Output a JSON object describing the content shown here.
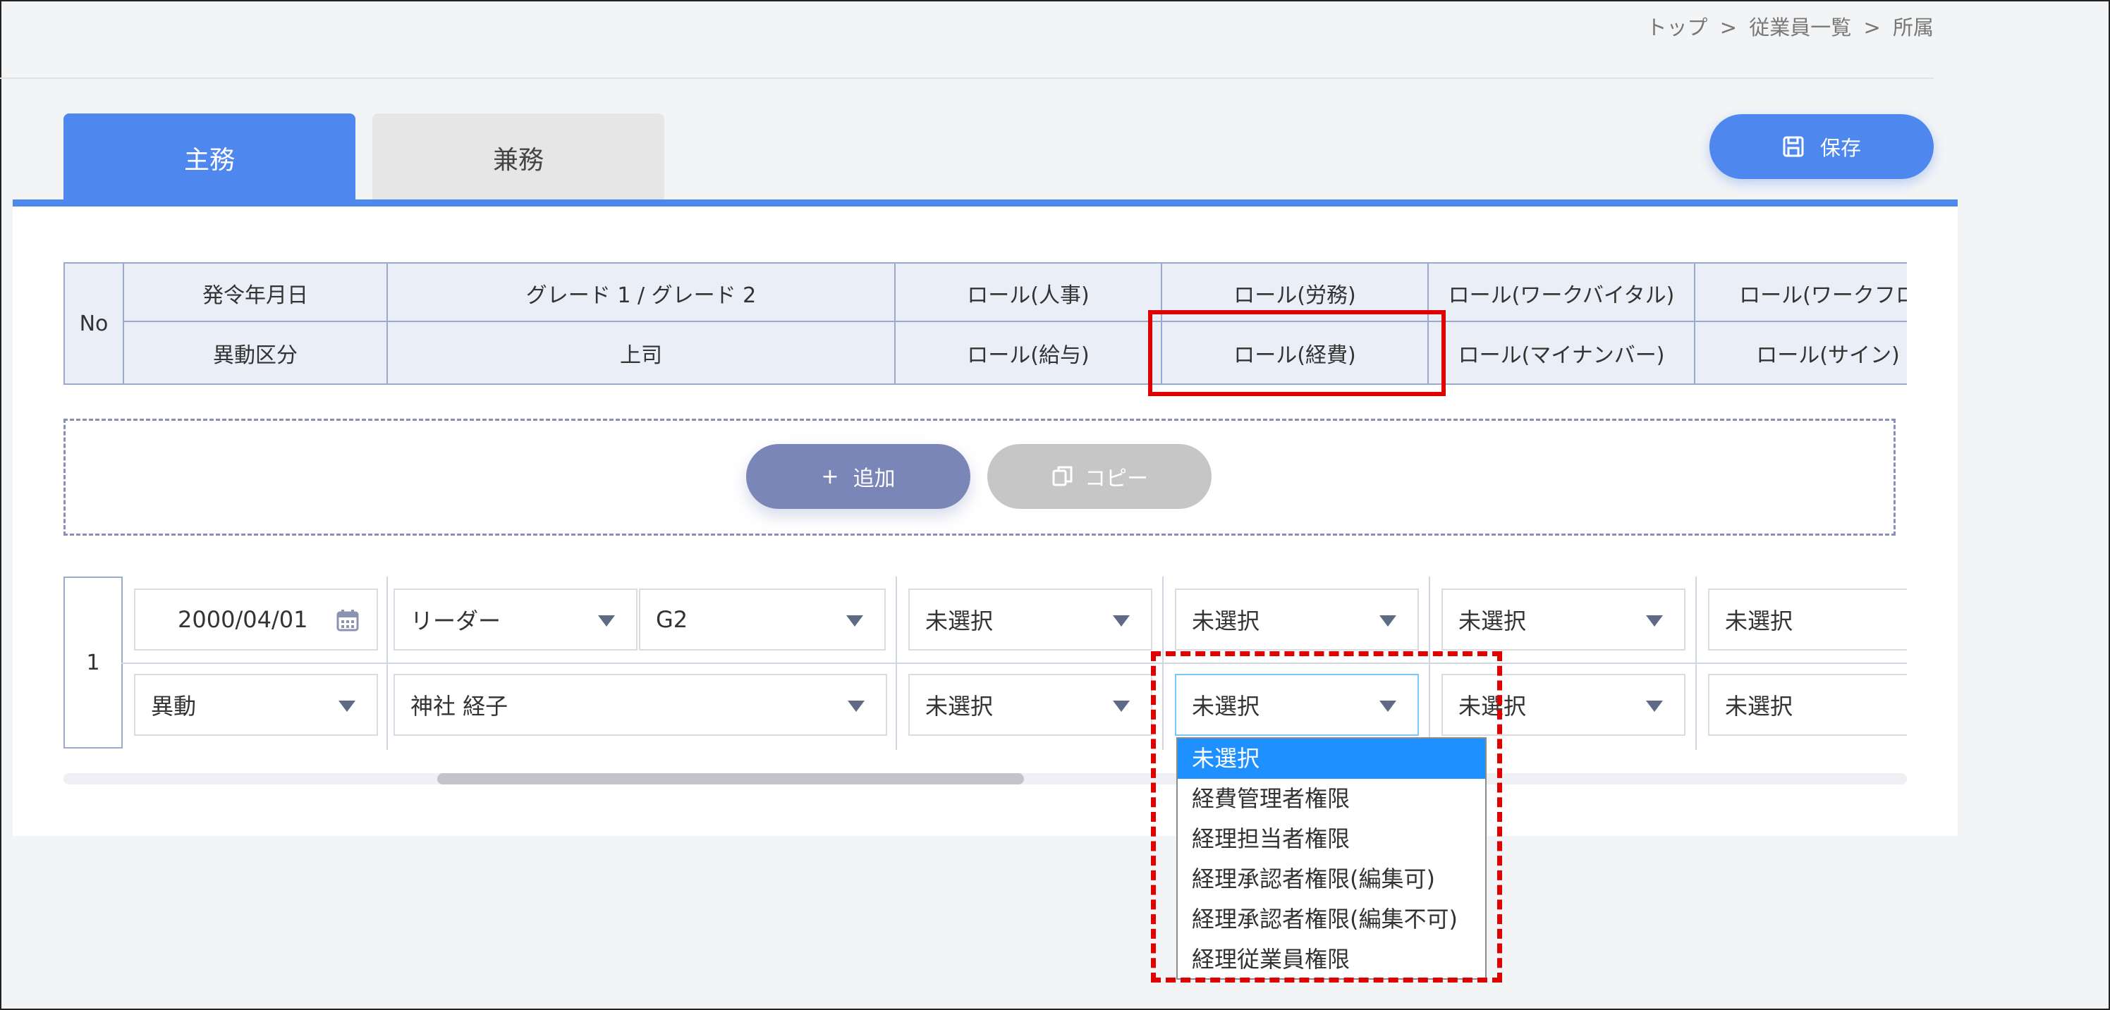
{
  "breadcrumb": {
    "items": [
      "トップ",
      "従業員一覧",
      "所属"
    ],
    "sep1": ">",
    "sep2": ">"
  },
  "tabs": {
    "main": "主務",
    "sub": "兼務"
  },
  "save_button": {
    "label": "保存",
    "icon": "floppy-disk-icon"
  },
  "header": {
    "no": "No",
    "row1": [
      "発令年月日",
      "グレード 1 / グレード 2",
      "ロール(人事)",
      "ロール(労務)",
      "ロール(ワークバイタル)",
      "ロール(ワークフロ"
    ],
    "row2": [
      "異動区分",
      "上司",
      "ロール(給与)",
      "ロール(経費)",
      "ロール(マイナンバー)",
      "ロール(サイン)"
    ]
  },
  "actions": {
    "add_icon": "+",
    "add": "追加",
    "copy": "コピー",
    "copy_icon": "copy-icon"
  },
  "row": {
    "no": "1",
    "date": "2000/04/01",
    "grade1": "リーダー",
    "grade2": "G2",
    "role_hr": "未選択",
    "role_labor": "未選択",
    "role_workvital": "未選択",
    "role_workflow": "未選択",
    "transfer_type": "異動",
    "boss": "神社 経子",
    "role_payroll": "未選択",
    "role_expense": "未選択",
    "role_mynumber": "未選択",
    "role_sign": "未選択"
  },
  "dropdown": {
    "options": [
      "未選択",
      "経費管理者権限",
      "経理担当者権限",
      "経理承認者権限(編集可)",
      "経理承認者権限(編集不可)",
      "経理従業員権限"
    ],
    "selected_index": 0
  },
  "colors": {
    "accent": "#4e88ee",
    "highlight": "#e00000",
    "header_bg": "#e9eef7",
    "dropdown_selected": "#1e90ff"
  }
}
